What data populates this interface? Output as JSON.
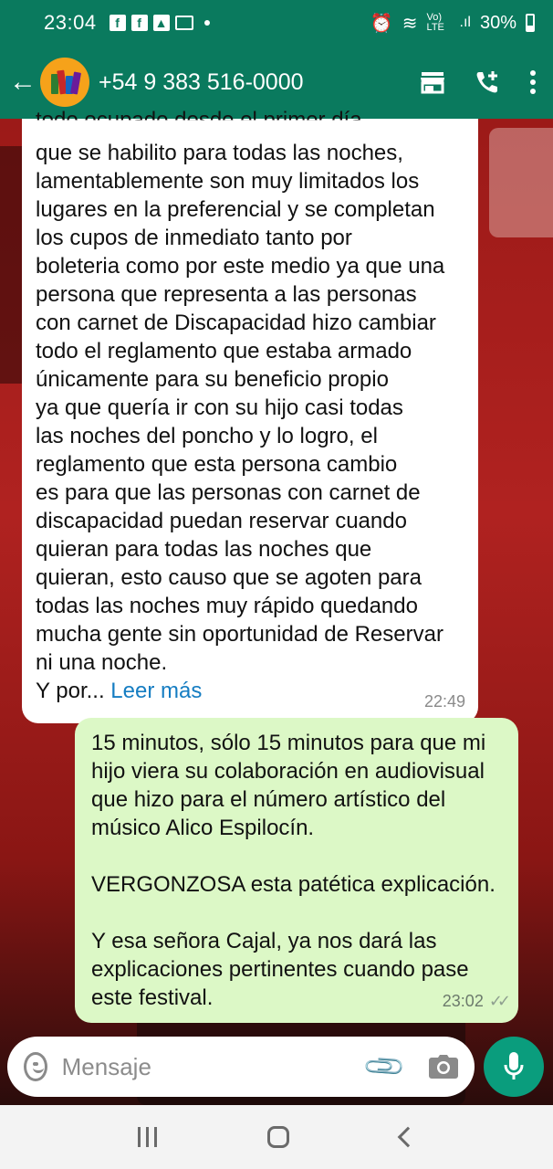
{
  "status_bar": {
    "time": "23:04",
    "notification_icons": [
      "facebook-icon",
      "facebook-icon",
      "gallery-icon",
      "cast-icon"
    ],
    "network": "Vo) LTE",
    "battery": "30%"
  },
  "header": {
    "contact": "+54 9 383 516-0000",
    "actions": [
      "store-icon",
      "add-call-icon",
      "more-icon"
    ]
  },
  "messages": {
    "incoming": {
      "clipped_top": "todo ocupado desde el primer día",
      "text": "que se habilito para todas las noches,\nlamentablemente son muy limitados los\nlugares en la preferencial y se completan\nlos cupos de inmediato tanto por\nboleteria como por este medio ya que una\npersona que representa a las personas\ncon carnet de Discapacidad hizo cambiar\ntodo el reglamento que estaba armado\núnicamente para su beneficio propio\nya que quería ir con su hijo casi todas\nlas noches del poncho y lo logro, el\nreglamento que esta persona cambio\nes para que las personas con carnet de\ndiscapacidad puedan reservar cuando\nquieran para todas las noches que\nquieran, esto causo que se agoten para\ntodas las noches muy rápido quedando\nmucha gente sin oportunidad de Reservar\nni una noche.",
      "truncated_prefix": "Y por...",
      "read_more": "Leer más",
      "time": "22:49"
    },
    "outgoing": {
      "text": "15 minutos, sólo 15 minutos para que mi\nhijo viera su colaboración en audiovisual\nque hizo para el número artístico del\nmúsico Alico Espilocín.\n\nVERGONZOSA esta patética explicación.\n\nY esa señora Cajal, ya nos dará las\nexplicaciones pertinentes cuando pase\neste festival.",
      "time": "23:02"
    }
  },
  "composer": {
    "placeholder": "Mensaje"
  }
}
